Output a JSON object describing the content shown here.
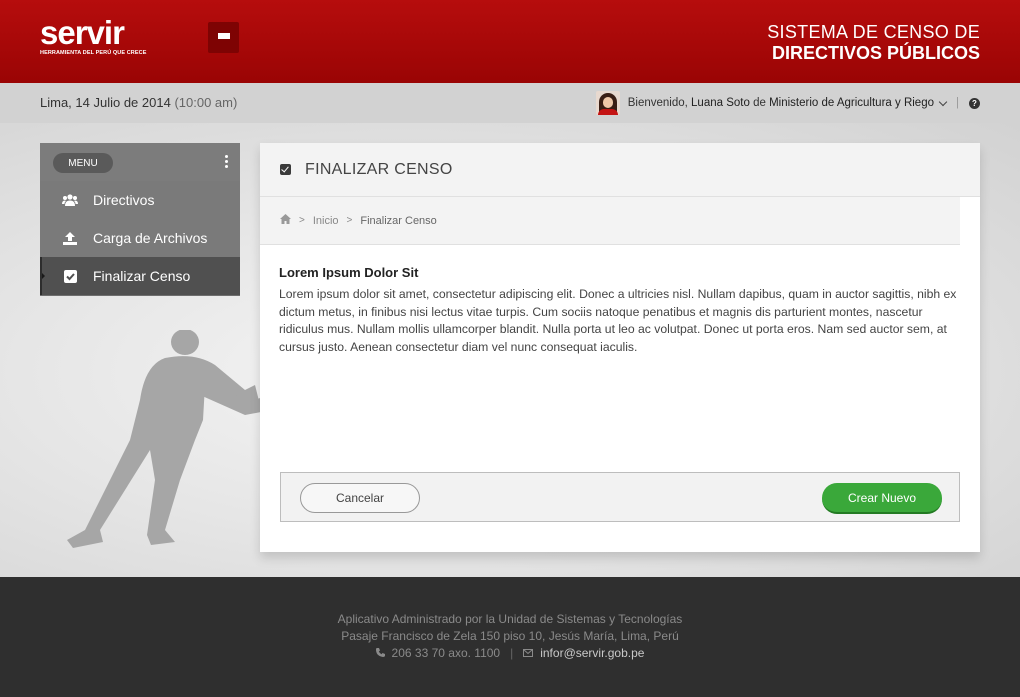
{
  "header": {
    "logo_word": "servir",
    "logo_tagline": "HERRAMIENTA DEL PERÚ QUE CRECE",
    "system_title_line1": "SISTEMA DE CENSO  DE",
    "system_title_line2": "DIRECTIVOS PÚBLICOS",
    "brand_color": "#a80808"
  },
  "infobar": {
    "date": "Lima, 14 Julio de 2014",
    "time": "(10:00 am)",
    "welcome": "Bienvenido,",
    "user_name": "Luana Soto",
    "de": "de",
    "organization": "Ministerio de Agricultura y Riego",
    "separator": "|"
  },
  "sidebar": {
    "menu_label": "MENU",
    "items": [
      {
        "label": "Directivos",
        "icon": "users-icon"
      },
      {
        "label": "Carga de Archivos",
        "icon": "upload-icon"
      },
      {
        "label": "Finalizar Censo",
        "icon": "checkbox-icon",
        "active": true
      }
    ]
  },
  "main": {
    "title": "FINALIZAR CENSO",
    "breadcrumb": {
      "home_icon": "home-icon",
      "items": [
        "Inicio",
        "Finalizar Censo"
      ]
    },
    "heading": "Lorem Ipsum Dolor Sit",
    "body": "Lorem ipsum dolor sit amet, consectetur adipiscing elit. Donec a ultricies nisl. Nullam dapibus, quam in auctor sagittis, nibh ex dictum metus, in finibus nisi lectus vitae turpis. Cum sociis natoque penatibus et magnis dis parturient montes, nascetur ridiculus mus. Nullam mollis ullamcorper blandit. Nulla porta ut leo ac volutpat. Donec ut porta eros. Nam sed auctor sem, at cursus justo. Aenean consectetur diam vel nunc consequat iaculis.",
    "cancel_label": "Cancelar",
    "create_label": "Crear Nuevo",
    "accent_green": "#3aa83a"
  },
  "footer": {
    "line1": "Aplicativo Administrado por la Unidad de Sistemas y Tecnologías",
    "line2": "Pasaje Francisco de Zela 150 piso 10, Jesús María, Lima, Perú",
    "phone": "206 33 70 axo. 1100",
    "separator": "|",
    "email": "infor@servir.gob.pe"
  }
}
